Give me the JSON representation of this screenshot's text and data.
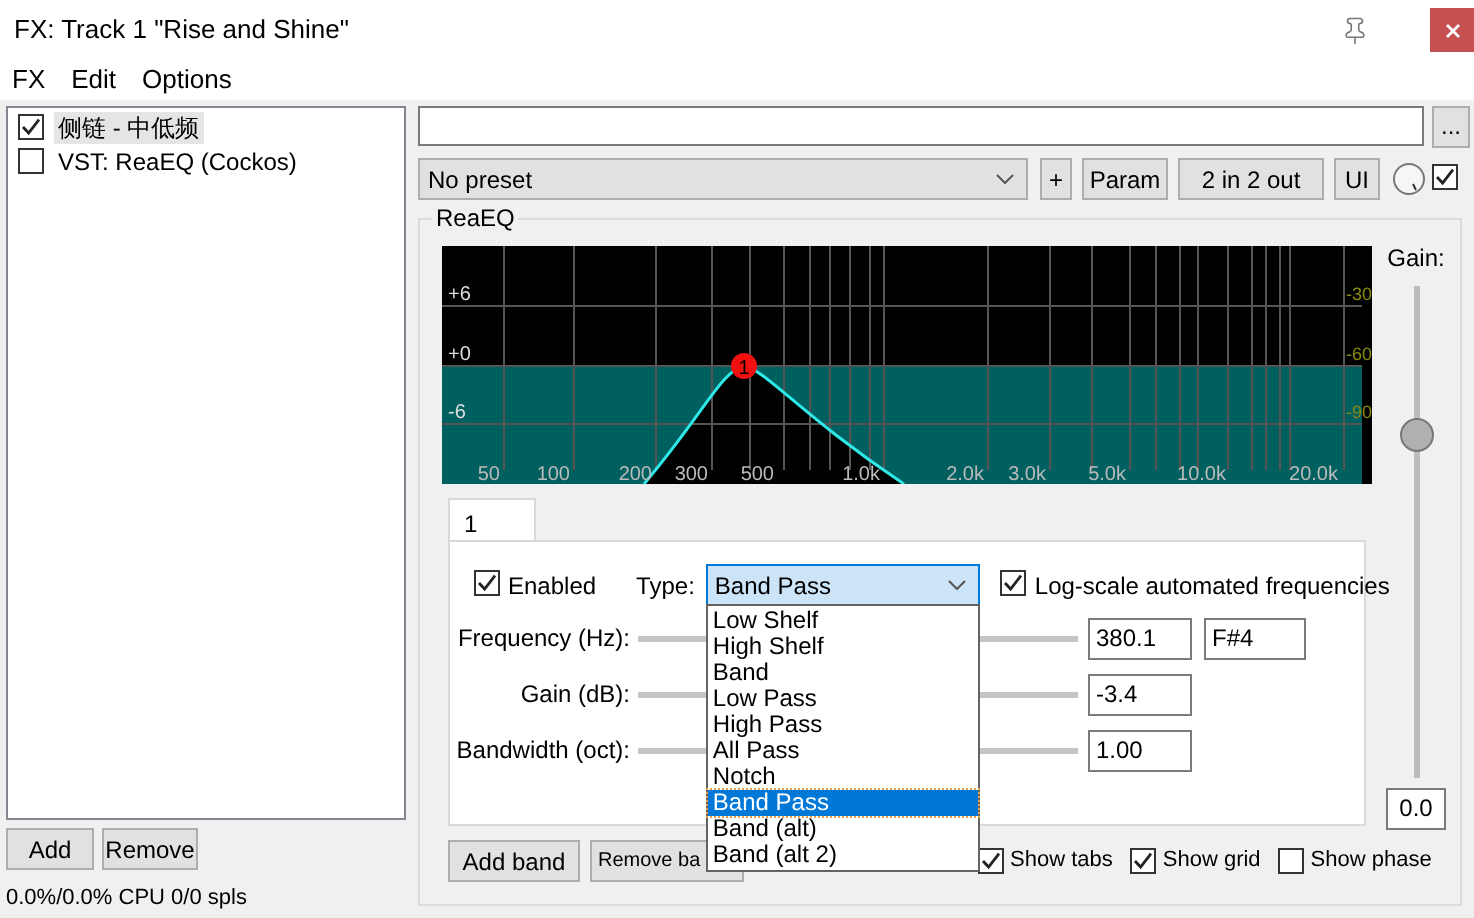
{
  "window": {
    "title": "FX: Track 1 \"Rise and Shine\""
  },
  "menu": [
    "FX",
    "Edit",
    "Options"
  ],
  "fx_chain": [
    {
      "name": "侧链 - 中低频",
      "enabled": true,
      "selected": true
    },
    {
      "name": "VST: ReaEQ (Cockos)",
      "enabled": false,
      "selected": false
    }
  ],
  "chain_buttons": [
    "Add",
    "Remove"
  ],
  "cpu_status": "0.0%/0.0% CPU 0/0 spls",
  "more_button": "...",
  "preset": {
    "value": "No preset"
  },
  "toolbar_buttons": [
    "+",
    "Param",
    "2 in 2 out",
    "UI"
  ],
  "bypass_checked": true,
  "plugin": {
    "title": "ReaEQ",
    "graph": {
      "left_labels": [
        "+6",
        "+0",
        "-6"
      ],
      "right_labels": [
        "-30",
        "-60",
        "-90"
      ],
      "x_labels": [
        "50",
        "100",
        "200",
        "300",
        "500",
        "1.0k",
        "2.0k",
        "3.0k",
        "5.0k",
        "10.0k",
        "20.0k"
      ],
      "node_label": "1"
    },
    "gain": {
      "label": "Gain:",
      "level": 0.7,
      "value": "0.0"
    },
    "band_tabs": [
      {
        "label": "1",
        "selected": true
      }
    ],
    "band": {
      "enabled": {
        "label": "Enabled",
        "checked": true
      },
      "type": {
        "label": "Type:",
        "value": "Band Pass",
        "expanded": true,
        "options": [
          {
            "label": "Low Shelf",
            "selected": false
          },
          {
            "label": "High Shelf",
            "selected": false
          },
          {
            "label": "Band",
            "selected": false
          },
          {
            "label": "Low Pass",
            "selected": false
          },
          {
            "label": "High Pass",
            "selected": false
          },
          {
            "label": "All Pass",
            "selected": false
          },
          {
            "label": "Notch",
            "selected": false
          },
          {
            "label": "Band Pass",
            "selected": true
          },
          {
            "label": "Band (alt)",
            "selected": false
          },
          {
            "label": "Band (alt 2)",
            "selected": false
          }
        ]
      },
      "log_scale": {
        "label": "Log-scale automated frequencies",
        "checked": true
      },
      "params": [
        {
          "label": "Frequency (Hz):",
          "value": "380.1",
          "note": "F#4"
        },
        {
          "label": "Gain (dB):",
          "value": "-3.4"
        },
        {
          "label": "Bandwidth (oct):",
          "value": "1.00"
        }
      ]
    },
    "buttons": [
      "Add band",
      "Remove ba"
    ],
    "options": [
      {
        "label": "Show tabs",
        "checked": true
      },
      {
        "label": "Show grid",
        "checked": true
      },
      {
        "label": "Show phase",
        "checked": false
      }
    ]
  }
}
